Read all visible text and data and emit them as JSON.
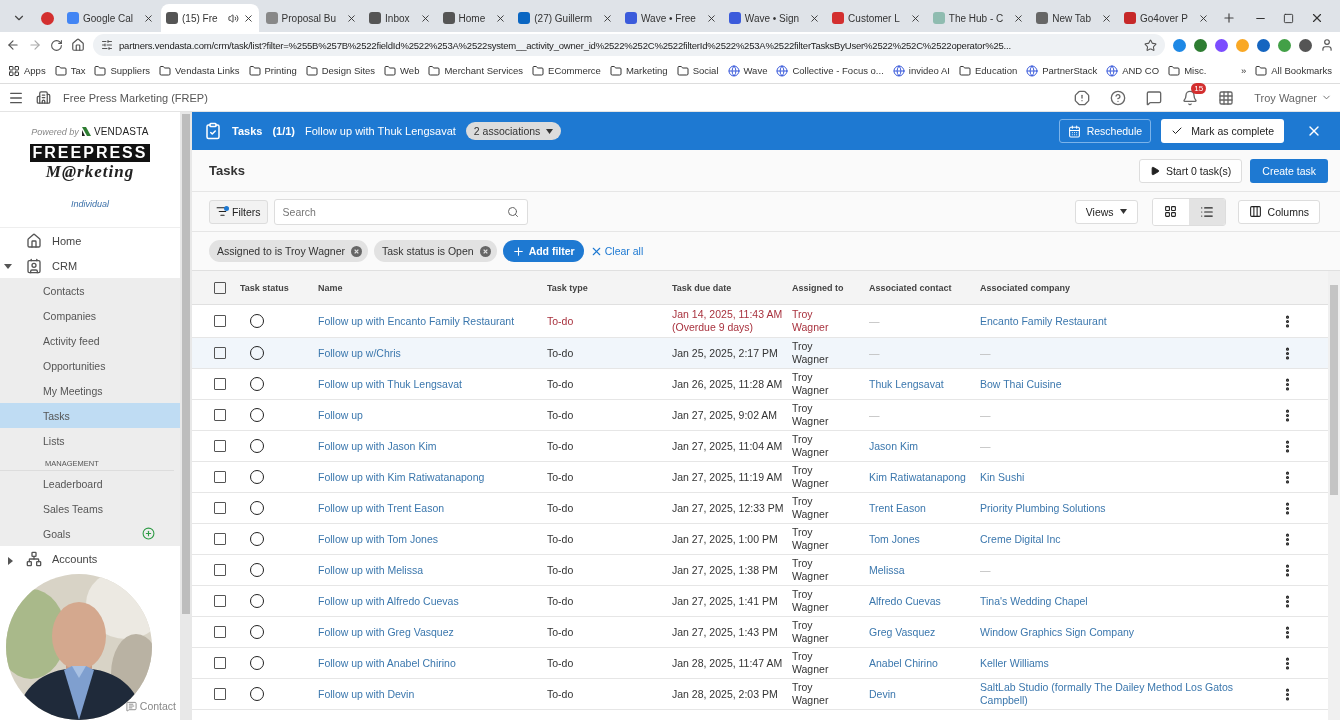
{
  "browser": {
    "tabs": [
      {
        "title": "Google Cal",
        "selected": false,
        "audio": false
      },
      {
        "title": "(15) Fre",
        "selected": true,
        "audio": true
      },
      {
        "title": "Proposal Bu",
        "selected": false,
        "audio": false
      },
      {
        "title": "Inbox",
        "selected": false,
        "audio": false
      },
      {
        "title": "Home",
        "selected": false,
        "audio": false
      },
      {
        "title": "(27) Guillerm",
        "selected": false,
        "audio": false
      },
      {
        "title": "Wave • Free",
        "selected": false,
        "audio": false
      },
      {
        "title": "Wave • Sign",
        "selected": false,
        "audio": false
      },
      {
        "title": "Customer L",
        "selected": false,
        "audio": false
      },
      {
        "title": "The Hub - C",
        "selected": false,
        "audio": false
      },
      {
        "title": "New Tab",
        "selected": false,
        "audio": false
      },
      {
        "title": "Go4over P",
        "selected": false,
        "audio": false
      }
    ],
    "url": "partners.vendasta.com/crm/task/list?filter=%255B%257B%2522fieldId%2522%253A%2522system__activity_owner_id%2522%252C%2522filterId%2522%253A%2522filterTasksByUser%2522%252C%2522operator%25...",
    "bookmarks": [
      {
        "label": "Apps",
        "kind": "apps"
      },
      {
        "label": "Tax",
        "kind": "folder"
      },
      {
        "label": "Suppliers",
        "kind": "folder"
      },
      {
        "label": "Vendasta Links",
        "kind": "folder"
      },
      {
        "label": "Printing",
        "kind": "folder"
      },
      {
        "label": "Design Sites",
        "kind": "folder"
      },
      {
        "label": "Web",
        "kind": "folder"
      },
      {
        "label": "Merchant Services",
        "kind": "folder"
      },
      {
        "label": "ECommerce",
        "kind": "folder"
      },
      {
        "label": "Marketing",
        "kind": "folder"
      },
      {
        "label": "Social",
        "kind": "folder"
      },
      {
        "label": "Wave",
        "kind": "site"
      },
      {
        "label": "Collective - Focus o...",
        "kind": "site"
      },
      {
        "label": "invideo AI",
        "kind": "site"
      },
      {
        "label": "Education",
        "kind": "folder"
      },
      {
        "label": "PartnerStack",
        "kind": "site"
      },
      {
        "label": "AND CO",
        "kind": "site"
      },
      {
        "label": "Misc.",
        "kind": "folder"
      }
    ],
    "more": "»",
    "all_bookmarks": "All Bookmarks"
  },
  "app": {
    "org": "Free Press Marketing (FREP)",
    "notification_count": "15",
    "user": "Troy Wagner"
  },
  "sidebar": {
    "powered_by": "Powered by",
    "vendor": "VENDASTA",
    "logo_top": "FREEPRESS",
    "logo_bottom": "M@rketing",
    "plan": "Individual",
    "items": [
      {
        "label": "Home",
        "kind": "home"
      },
      {
        "label": "CRM",
        "kind": "group",
        "expanded": true,
        "children": [
          {
            "label": "Contacts",
            "kind": "link",
            "selected": false
          },
          {
            "label": "Companies",
            "kind": "link",
            "selected": false
          },
          {
            "label": "Activity feed",
            "kind": "link",
            "selected": false
          },
          {
            "label": "Opportunities",
            "kind": "link",
            "selected": false
          },
          {
            "label": "My Meetings",
            "kind": "link",
            "selected": false
          },
          {
            "label": "Tasks",
            "kind": "link",
            "selected": true
          },
          {
            "label": "Lists",
            "kind": "link",
            "selected": false
          },
          {
            "label": "MANAGEMENT",
            "kind": "heading"
          },
          {
            "label": "Leaderboard",
            "kind": "link",
            "selected": false
          },
          {
            "label": "Sales Teams",
            "kind": "link",
            "selected": false
          },
          {
            "label": "Goals",
            "kind": "add",
            "selected": false
          }
        ]
      },
      {
        "label": "Accounts",
        "kind": "group",
        "expanded": false
      }
    ],
    "footer": "Contact"
  },
  "task_bar": {
    "title": "Tasks",
    "count": "(1/1)",
    "task": "Follow up with Thuk Lengsavat",
    "associations": "2 associations",
    "reschedule": "Reschedule",
    "complete": "Mark as complete"
  },
  "page": {
    "title": "Tasks",
    "start": "Start 0 task(s)",
    "create": "Create task",
    "filters": "Filters",
    "search_placeholder": "Search",
    "views": "Views",
    "layout": [
      {
        "kind": "grid",
        "selected": false
      },
      {
        "kind": "list",
        "selected": true
      }
    ],
    "columns_button": "Columns",
    "chips": [
      "Assigned to is Troy Wagner",
      "Task status is Open"
    ],
    "add_filter": "Add filter",
    "clear_all": "Clear all"
  },
  "table": {
    "columns": [
      "Task status",
      "Name",
      "Task type",
      "Task due date",
      "Assigned to",
      "Associated contact",
      "Associated company"
    ],
    "select_all": {
      "checked": false
    },
    "rows": [
      {
        "checked": false,
        "highlighted": false,
        "overdue": true,
        "name": "Follow up with Encanto Family Restaurant",
        "type": "To-do",
        "due": "Jan 14, 2025, 11:43 AM",
        "overdue_note": "(Overdue 9 days)",
        "assigned": "Troy Wagner",
        "contact": "—",
        "company": "Encanto Family Restaurant"
      },
      {
        "checked": false,
        "highlighted": true,
        "overdue": false,
        "name": "Follow up w/Chris",
        "type": "To-do",
        "due": "Jan 25, 2025, 2:17 PM",
        "assigned": "Troy Wagner",
        "contact": "—",
        "company": "—"
      },
      {
        "checked": false,
        "highlighted": false,
        "overdue": false,
        "name": "Follow up with Thuk Lengsavat",
        "type": "To-do",
        "due": "Jan 26, 2025, 11:28 AM",
        "assigned": "Troy Wagner",
        "contact": "Thuk Lengsavat",
        "company": "Bow Thai Cuisine"
      },
      {
        "checked": false,
        "highlighted": false,
        "overdue": false,
        "name": "Follow up",
        "type": "To-do",
        "due": "Jan 27, 2025, 9:02 AM",
        "assigned": "Troy Wagner",
        "contact": "—",
        "company": "—"
      },
      {
        "checked": false,
        "highlighted": false,
        "overdue": false,
        "name": "Follow up with Jason Kim",
        "type": "To-do",
        "due": "Jan 27, 2025, 11:04 AM",
        "assigned": "Troy Wagner",
        "contact": "Jason Kim",
        "company": "—"
      },
      {
        "checked": false,
        "highlighted": false,
        "overdue": false,
        "name": "Follow up with Kim Ratiwatanapong",
        "type": "To-do",
        "due": "Jan 27, 2025, 11:19 AM",
        "assigned": "Troy Wagner",
        "contact": "Kim Ratiwatanapong",
        "company": "Kin Sushi"
      },
      {
        "checked": false,
        "highlighted": false,
        "overdue": false,
        "name": "Follow up with Trent Eason",
        "type": "To-do",
        "due": "Jan 27, 2025, 12:33 PM",
        "assigned": "Troy Wagner",
        "contact": "Trent Eason",
        "company": "Priority Plumbing Solutions"
      },
      {
        "checked": false,
        "highlighted": false,
        "overdue": false,
        "name": "Follow up with Tom Jones",
        "type": "To-do",
        "due": "Jan 27, 2025, 1:00 PM",
        "assigned": "Troy Wagner",
        "contact": "Tom Jones",
        "company": "Creme Digital Inc"
      },
      {
        "checked": false,
        "highlighted": false,
        "overdue": false,
        "name": "Follow up with Melissa",
        "type": "To-do",
        "due": "Jan 27, 2025, 1:38 PM",
        "assigned": "Troy Wagner",
        "contact": "Melissa",
        "company": "—"
      },
      {
        "checked": false,
        "highlighted": false,
        "overdue": false,
        "name": "Follow up with Alfredo Cuevas",
        "type": "To-do",
        "due": "Jan 27, 2025, 1:41 PM",
        "assigned": "Troy Wagner",
        "contact": "Alfredo Cuevas",
        "company": "Tina's Wedding Chapel"
      },
      {
        "checked": false,
        "highlighted": false,
        "overdue": false,
        "name": "Follow up with Greg Vasquez",
        "type": "To-do",
        "due": "Jan 27, 2025, 1:43 PM",
        "assigned": "Troy Wagner",
        "contact": "Greg Vasquez",
        "company": "Window Graphics Sign Company"
      },
      {
        "checked": false,
        "highlighted": false,
        "overdue": false,
        "name": "Follow up with Anabel Chirino",
        "type": "To-do",
        "due": "Jan 28, 2025, 11:47 AM",
        "assigned": "Troy Wagner",
        "contact": "Anabel Chirino",
        "company": "Keller Williams"
      },
      {
        "checked": false,
        "highlighted": false,
        "overdue": false,
        "name": "Follow up with Devin",
        "type": "To-do",
        "due": "Jan 28, 2025, 2:03 PM",
        "assigned": "Troy Wagner",
        "contact": "Devin",
        "company": "SaltLab Studio (formally The Dailey Method Los Gatos Campbell)"
      }
    ]
  }
}
